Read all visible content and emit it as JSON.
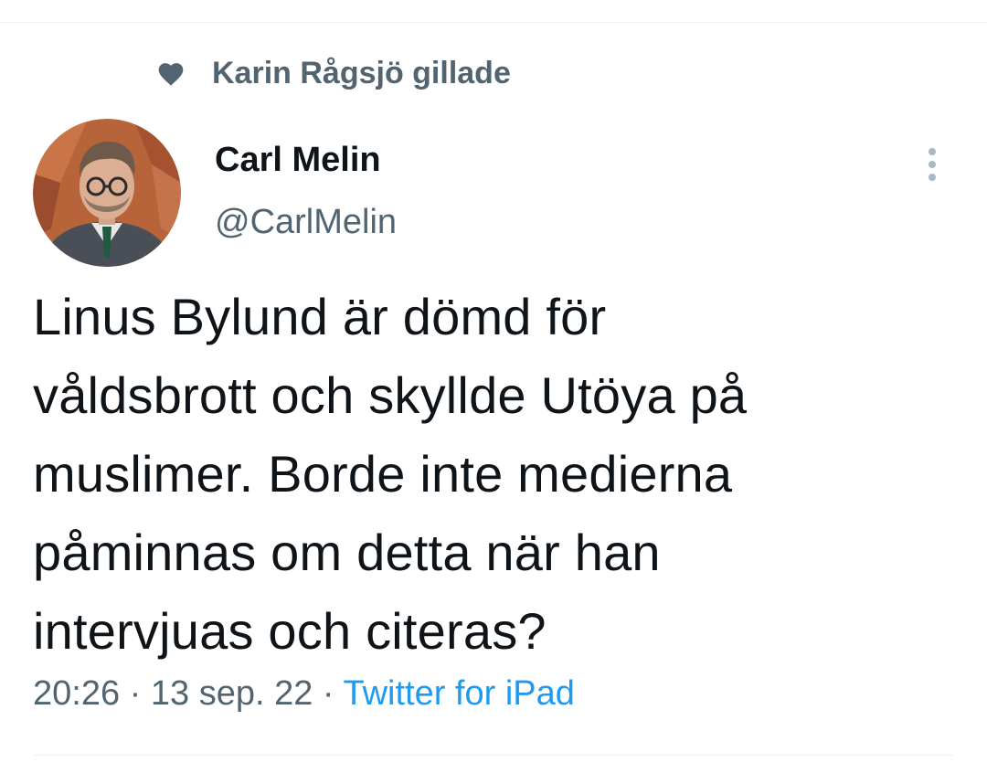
{
  "social_context": {
    "text": "Karin Rågsjö gillade",
    "icon": "heart-icon"
  },
  "author": {
    "name": "Carl Melin",
    "handle": "@CarlMelin",
    "avatar": "avatar-photo"
  },
  "tweet": {
    "lines": [
      "Linus Bylund är dömd för",
      "våldsbrott och skyllde Utöya på",
      "muslimer. Borde inte medierna",
      "påminnas om detta när han",
      "intervjuas och citeras?"
    ]
  },
  "meta": {
    "time": "20:26",
    "separator": "·",
    "date": "13 sep. 22",
    "source": "Twitter for iPad"
  },
  "colors": {
    "text_primary": "#0f1419",
    "text_secondary": "#536471",
    "link": "#1d9bf0",
    "divider": "#eff3f4"
  }
}
